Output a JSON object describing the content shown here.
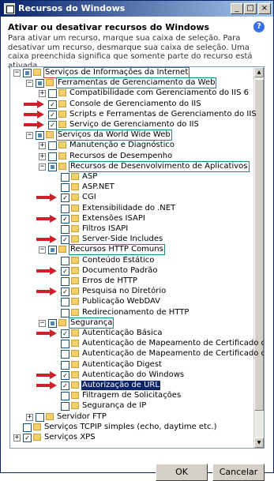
{
  "window": {
    "title": "Recursos do Windows",
    "minimize": "_",
    "maximize": "□",
    "close": "×"
  },
  "heading": "Ativar ou desativar recursos do Windows",
  "description": "Para ativar um recurso, marque sua caixa de seleção. Para desativar um recurso, desmarque sua caixa de seleção. Uma caixa preenchida significa que somente parte do recurso está ativada.",
  "tree": [
    {
      "id": "iis",
      "label": "Serviços de Informações da Internet",
      "level": 0,
      "expander": "−",
      "check": "partial",
      "highlight": "red",
      "arrow": false
    },
    {
      "id": "mgmt-tools",
      "label": "Ferramentas de Gerenciamento da Web",
      "level": 1,
      "expander": "−",
      "check": "partial",
      "highlight": "teal",
      "arrow": false
    },
    {
      "id": "iis6-compat",
      "label": "Compatibilidade com Gerenciamento do IIS 6",
      "level": 2,
      "expander": "+",
      "check": "none",
      "highlight": "",
      "arrow": false
    },
    {
      "id": "iis-console",
      "label": "Console de Gerenciamento do IIS",
      "level": 2,
      "expander": "",
      "check": "checked",
      "highlight": "",
      "arrow": true
    },
    {
      "id": "iis-scripts",
      "label": "Scripts e Ferramentas de Gerenciamento do IIS",
      "level": 2,
      "expander": "",
      "check": "checked",
      "highlight": "",
      "arrow": true
    },
    {
      "id": "iis-mgmt-service",
      "label": "Serviço de Gerenciamento do IIS",
      "level": 2,
      "expander": "",
      "check": "checked",
      "highlight": "",
      "arrow": true
    },
    {
      "id": "www",
      "label": "Serviços da World Wide Web",
      "level": 1,
      "expander": "−",
      "check": "partial",
      "highlight": "teal",
      "arrow": false
    },
    {
      "id": "maint-diag",
      "label": "Manutenção e Diagnóstico",
      "level": 2,
      "expander": "+",
      "check": "none",
      "highlight": "",
      "arrow": false
    },
    {
      "id": "perf",
      "label": "Recursos de Desempenho",
      "level": 2,
      "expander": "+",
      "check": "none",
      "highlight": "",
      "arrow": false
    },
    {
      "id": "app-dev",
      "label": "Recursos de Desenvolvimento de Aplicativos",
      "level": 2,
      "expander": "−",
      "check": "partial",
      "highlight": "teal",
      "arrow": false
    },
    {
      "id": "asp",
      "label": "ASP",
      "level": 3,
      "expander": "",
      "check": "none",
      "highlight": "",
      "arrow": false
    },
    {
      "id": "aspnet",
      "label": "ASP.NET",
      "level": 3,
      "expander": "",
      "check": "none",
      "highlight": "",
      "arrow": false
    },
    {
      "id": "cgi",
      "label": "CGI",
      "level": 3,
      "expander": "",
      "check": "checked",
      "highlight": "",
      "arrow": true
    },
    {
      "id": "net-ext",
      "label": "Extensibilidade do .NET",
      "level": 3,
      "expander": "",
      "check": "none",
      "highlight": "",
      "arrow": false
    },
    {
      "id": "isapi-ext",
      "label": "Extensões ISAPI",
      "level": 3,
      "expander": "",
      "check": "checked",
      "highlight": "",
      "arrow": true
    },
    {
      "id": "isapi-filters",
      "label": "Filtros ISAPI",
      "level": 3,
      "expander": "",
      "check": "none",
      "highlight": "",
      "arrow": false
    },
    {
      "id": "ssi",
      "label": "Server-Side Includes",
      "level": 3,
      "expander": "",
      "check": "checked",
      "highlight": "",
      "arrow": true
    },
    {
      "id": "http-common",
      "label": "Recursos HTTP Comuns",
      "level": 2,
      "expander": "−",
      "check": "partial",
      "highlight": "teal",
      "arrow": false
    },
    {
      "id": "static",
      "label": "Conteúdo Estático",
      "level": 3,
      "expander": "",
      "check": "none",
      "highlight": "",
      "arrow": false
    },
    {
      "id": "default-doc",
      "label": "Documento Padrão",
      "level": 3,
      "expander": "",
      "check": "checked",
      "highlight": "",
      "arrow": true
    },
    {
      "id": "http-errors",
      "label": "Erros de HTTP",
      "level": 3,
      "expander": "",
      "check": "none",
      "highlight": "",
      "arrow": false
    },
    {
      "id": "dir-browse",
      "label": "Pesquisa no Diretório",
      "level": 3,
      "expander": "",
      "check": "checked",
      "highlight": "",
      "arrow": true
    },
    {
      "id": "webdav",
      "label": "Publicação WebDAV",
      "level": 3,
      "expander": "",
      "check": "none",
      "highlight": "",
      "arrow": false
    },
    {
      "id": "http-redirect",
      "label": "Redirecionamento de HTTP",
      "level": 3,
      "expander": "",
      "check": "none",
      "highlight": "",
      "arrow": false
    },
    {
      "id": "security",
      "label": "Segurança",
      "level": 2,
      "expander": "−",
      "check": "partial",
      "highlight": "teal",
      "arrow": false
    },
    {
      "id": "basic-auth",
      "label": "Autenticação Básica",
      "level": 3,
      "expander": "",
      "check": "checked",
      "highlight": "",
      "arrow": true
    },
    {
      "id": "cert-map-1",
      "label": "Autenticação de Mapeamento de Certificado de",
      "level": 3,
      "expander": "",
      "check": "none",
      "highlight": "",
      "arrow": false
    },
    {
      "id": "cert-map-2",
      "label": "Autenticação de Mapeamento de Certificado de",
      "level": 3,
      "expander": "",
      "check": "none",
      "highlight": "",
      "arrow": false
    },
    {
      "id": "digest-auth",
      "label": "Autenticação Digest",
      "level": 3,
      "expander": "",
      "check": "none",
      "highlight": "",
      "arrow": false
    },
    {
      "id": "windows-auth",
      "label": "Autenticação do Windows",
      "level": 3,
      "expander": "",
      "check": "checked",
      "highlight": "",
      "arrow": true
    },
    {
      "id": "url-auth",
      "label": "Autorização de URL",
      "level": 3,
      "expander": "",
      "check": "checked",
      "highlight": "sel",
      "arrow": true
    },
    {
      "id": "req-filter",
      "label": "Filtragem de Solicitações",
      "level": 3,
      "expander": "",
      "check": "none",
      "highlight": "",
      "arrow": false
    },
    {
      "id": "ip-security",
      "label": "Segurança de IP",
      "level": 3,
      "expander": "",
      "check": "none",
      "highlight": "",
      "arrow": false
    },
    {
      "id": "ftp",
      "label": "Servidor FTP",
      "level": 1,
      "expander": "+",
      "check": "none",
      "highlight": "",
      "arrow": false
    },
    {
      "id": "tcpip",
      "label": "Serviços TCPIP simples (echo, daytime etc.)",
      "level": 0,
      "expander": "",
      "check": "none",
      "highlight": "",
      "arrow": false
    },
    {
      "id": "xps",
      "label": "Serviços XPS",
      "level": 0,
      "expander": "+",
      "check": "checked",
      "highlight": "",
      "arrow": false
    }
  ],
  "buttons": {
    "ok": "OK",
    "cancel": "Cancelar"
  },
  "colors": {
    "arrow": "#cf1f2a",
    "red_box": "#c0392b",
    "teal_box": "#1a8a7a",
    "selection": "#0a246a",
    "titlebar": "#0a246a"
  }
}
